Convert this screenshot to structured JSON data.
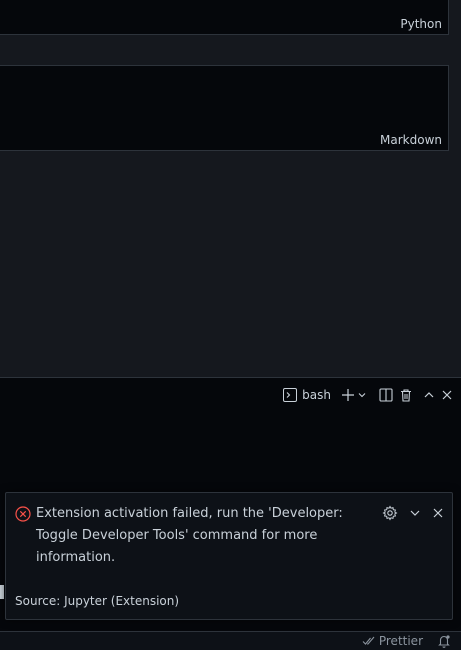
{
  "notebook": {
    "cells": [
      {
        "language": "Python"
      },
      {
        "language": "Markdown"
      }
    ]
  },
  "panel": {
    "terminal_name": "bash",
    "icons": [
      "terminal-icon",
      "plus-icon",
      "chevron-down-icon",
      "split-icon",
      "trash-icon",
      "chevron-up-icon",
      "close-icon"
    ]
  },
  "notification": {
    "severity_icon": "error-icon",
    "message": "Extension activation failed, run the 'Developer: Toggle Developer Tools' command for more information.",
    "source": "Source: Jupyter (Extension)",
    "colors": {
      "error": "#f85149"
    }
  },
  "statusbar": {
    "prettier_label": "Prettier",
    "icons": [
      "check-all-icon",
      "bell-icon"
    ]
  }
}
